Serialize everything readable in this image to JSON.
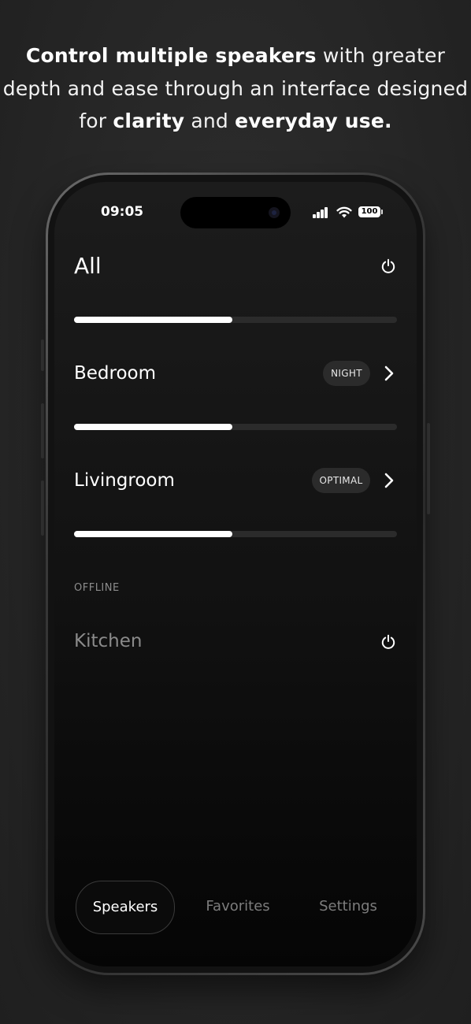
{
  "headline": {
    "part1_bold": "Control multiple speakers",
    "part2": " with greater depth and ease through an interface designed for ",
    "part3_bold": "clarity",
    "part4": " and ",
    "part5_bold": "everyday use."
  },
  "status_bar": {
    "time": "09:05",
    "battery": "100"
  },
  "speakers": {
    "all": {
      "name": "All",
      "volume_fraction": 0.49
    },
    "bedroom": {
      "name": "Bedroom",
      "mode": "NIGHT",
      "volume_fraction": 0.49
    },
    "livingroom": {
      "name": "Livingroom",
      "mode": "OPTIMAL",
      "volume_fraction": 0.49
    },
    "offline_label": "OFFLINE",
    "kitchen": {
      "name": "Kitchen"
    }
  },
  "tabs": [
    {
      "label": "Speakers",
      "active": true
    },
    {
      "label": "Favorites",
      "active": false
    },
    {
      "label": "Settings",
      "active": false
    }
  ],
  "colors": {
    "background": "#262626",
    "screen": "#141414",
    "slider_fill": "#ffffff",
    "slider_track": "#2b2b2b",
    "pill_bg": "#2b2b2b",
    "dim_text": "#8a8a8a"
  }
}
